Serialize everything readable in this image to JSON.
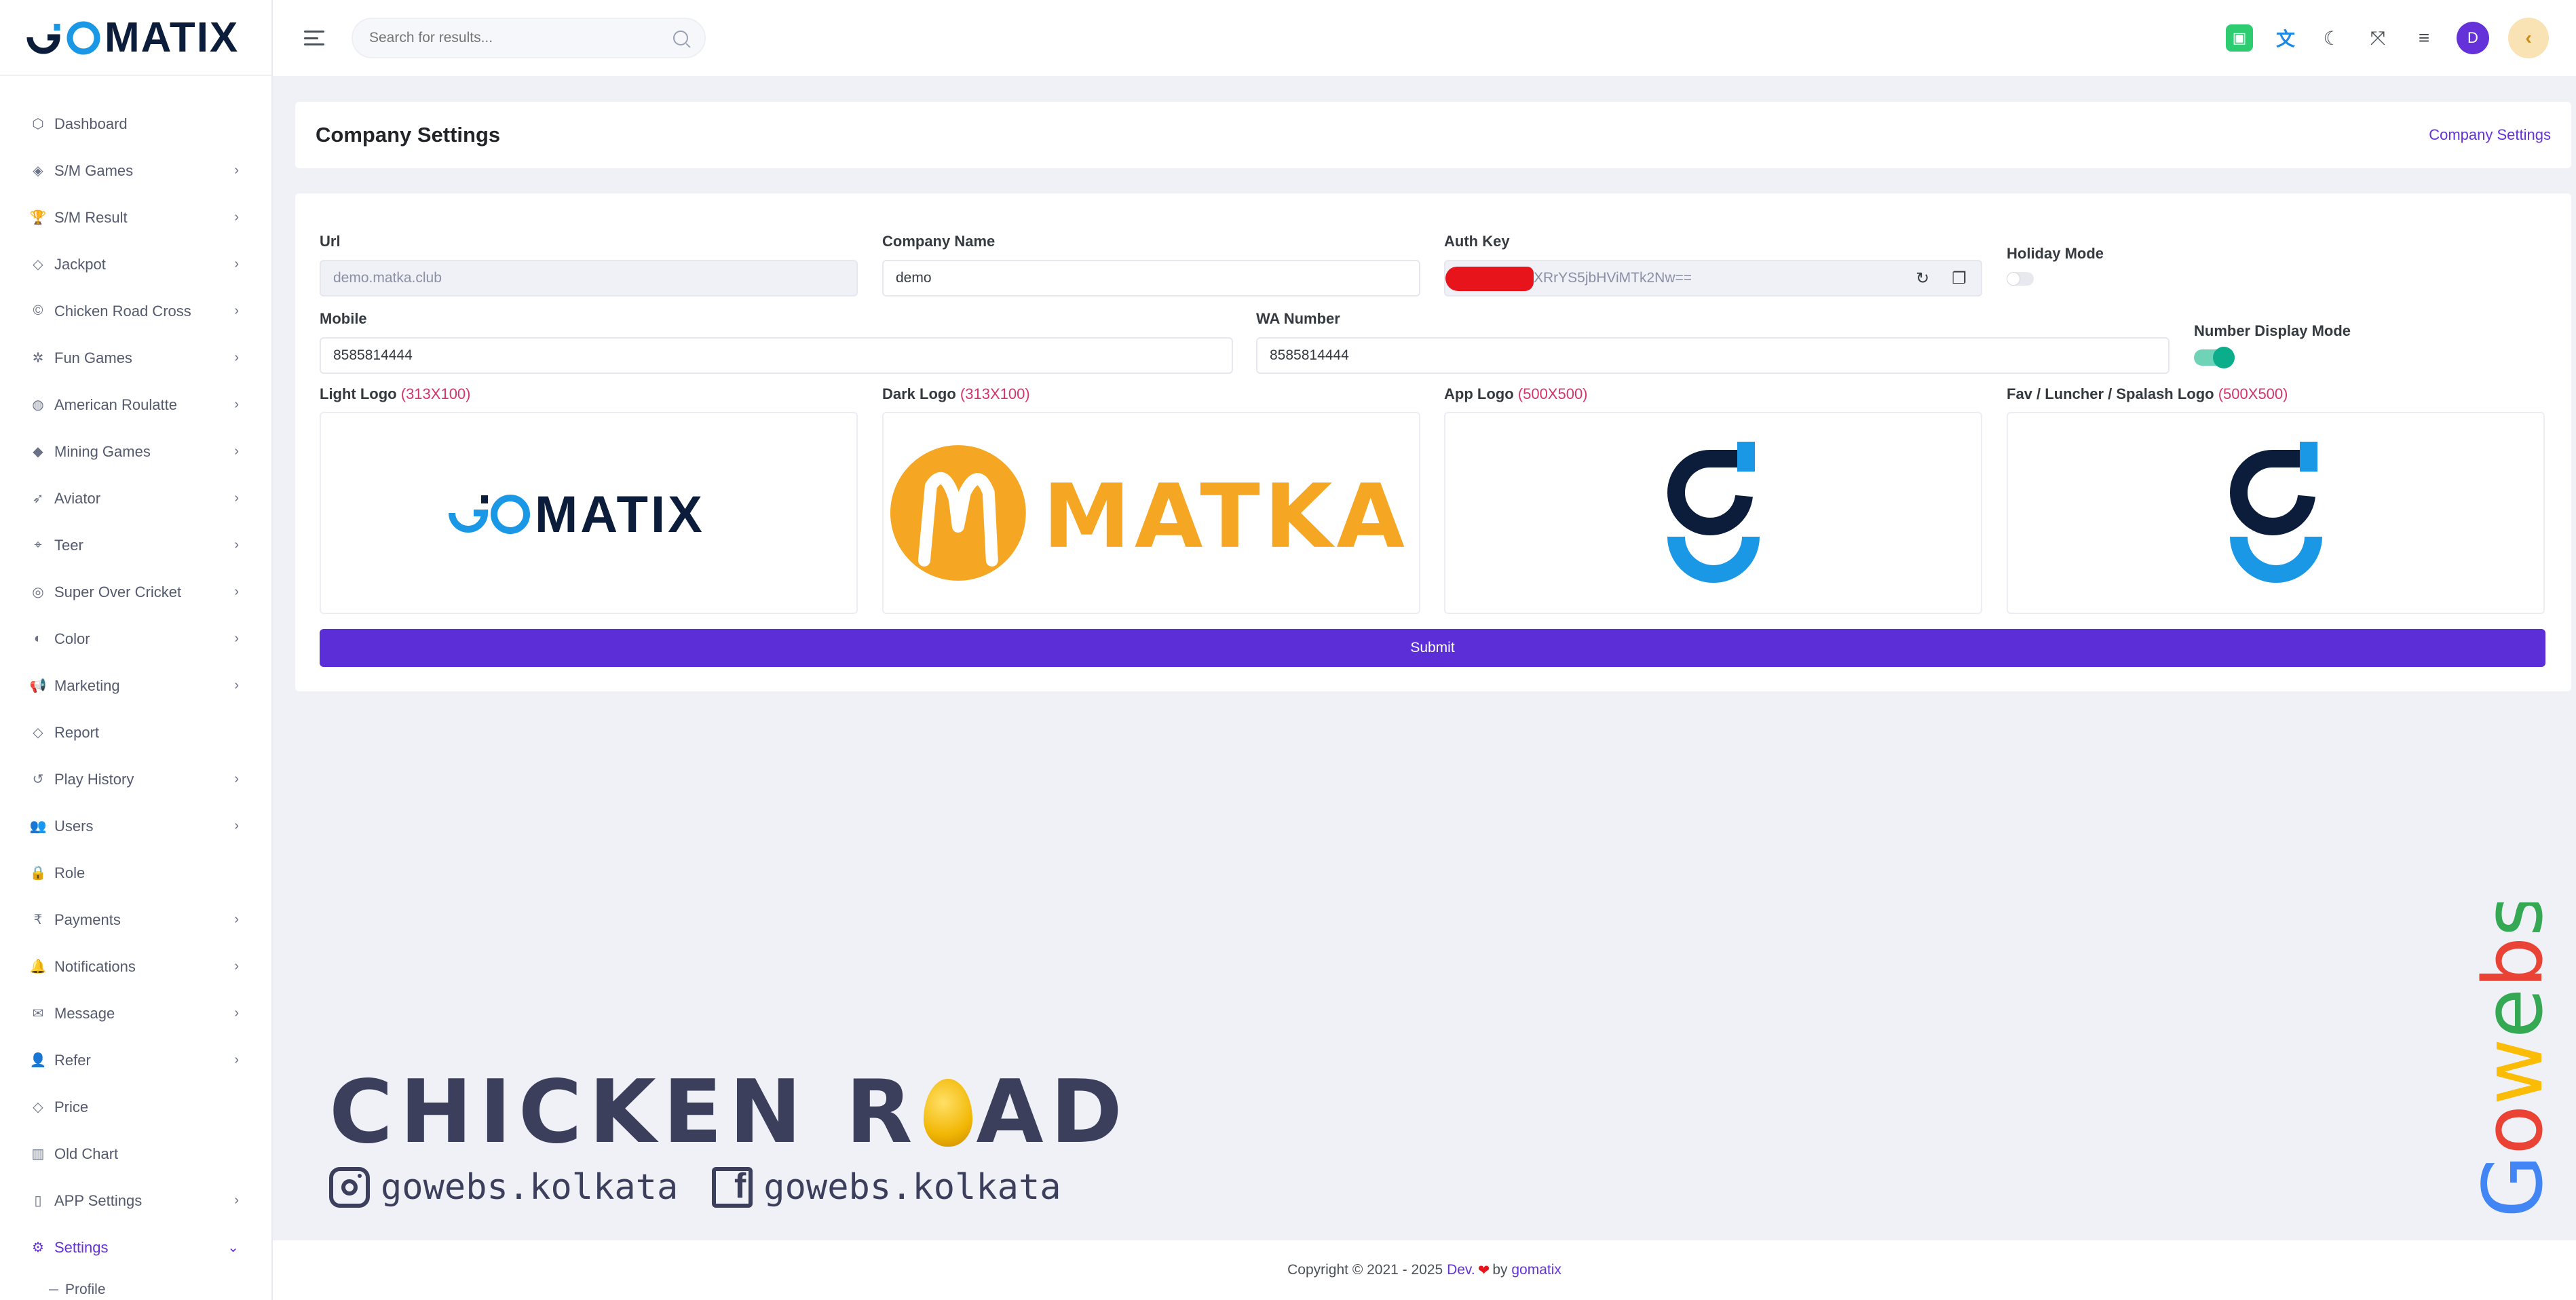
{
  "brand": {
    "name": "GOMATIX"
  },
  "sidebar": {
    "items": [
      {
        "label": "Dashboard",
        "icon": "cube-icon",
        "glyph": "⬡",
        "chevron": false
      },
      {
        "label": "S/M Games",
        "icon": "gamepad-icon",
        "glyph": "◈",
        "chevron": true
      },
      {
        "label": "S/M Result",
        "icon": "trophy-icon",
        "glyph": "🏆",
        "chevron": true
      },
      {
        "label": "Jackpot",
        "icon": "tag-icon",
        "glyph": "◇",
        "chevron": true
      },
      {
        "label": "Chicken Road Cross",
        "icon": "copyright-icon",
        "glyph": "©",
        "chevron": true
      },
      {
        "label": "Fun Games",
        "icon": "dharmachakra-icon",
        "glyph": "✲",
        "chevron": true
      },
      {
        "label": "American Roulatte",
        "icon": "globe-icon",
        "glyph": "◍",
        "chevron": true
      },
      {
        "label": "Mining Games",
        "icon": "gem-icon",
        "glyph": "◆",
        "chevron": true
      },
      {
        "label": "Aviator",
        "icon": "rocket-icon",
        "glyph": "➶",
        "chevron": true
      },
      {
        "label": "Teer",
        "icon": "crosshair-icon",
        "glyph": "⌖",
        "chevron": true
      },
      {
        "label": "Super Over Cricket",
        "icon": "baseball-icon",
        "glyph": "◎",
        "chevron": true
      },
      {
        "label": "Color",
        "icon": "half-circle-icon",
        "glyph": "◐",
        "chevron": true
      },
      {
        "label": "Marketing",
        "icon": "megaphone-icon",
        "glyph": "📢",
        "chevron": true
      },
      {
        "label": "Report",
        "icon": "tag-icon",
        "glyph": "◇",
        "chevron": false
      },
      {
        "label": "Play History",
        "icon": "history-icon",
        "glyph": "↺",
        "chevron": true
      },
      {
        "label": "Users",
        "icon": "users-icon",
        "glyph": "👥",
        "chevron": true
      },
      {
        "label": "Role",
        "icon": "lock-icon",
        "glyph": "🔒",
        "chevron": false
      },
      {
        "label": "Payments",
        "icon": "rupee-icon",
        "glyph": "₹",
        "chevron": true
      },
      {
        "label": "Notifications",
        "icon": "bell-icon",
        "glyph": "🔔",
        "chevron": true
      },
      {
        "label": "Message",
        "icon": "envelope-icon",
        "glyph": "✉",
        "chevron": true
      },
      {
        "label": "Refer",
        "icon": "user-plus-icon",
        "glyph": "👤",
        "chevron": true
      },
      {
        "label": "Price",
        "icon": "tag-icon",
        "glyph": "◇",
        "chevron": false
      },
      {
        "label": "Old Chart",
        "icon": "bar-chart-icon",
        "glyph": "▥",
        "chevron": false
      },
      {
        "label": "APP Settings",
        "icon": "mobile-icon",
        "glyph": "▯",
        "chevron": true
      },
      {
        "label": "Settings",
        "icon": "gear-icon",
        "glyph": "⚙",
        "chevron": true,
        "active": true
      }
    ],
    "submenu": [
      {
        "label": "Profile"
      }
    ]
  },
  "header": {
    "search_placeholder": "Search for results...",
    "avatar_initial": "D"
  },
  "page": {
    "title": "Company Settings",
    "breadcrumb": "Company Settings"
  },
  "form": {
    "url": {
      "label": "Url",
      "value": "demo.matka.club"
    },
    "company_name": {
      "label": "Company Name",
      "value": "demo"
    },
    "auth_key": {
      "label": "Auth Key",
      "value": "XRrYS5jbHViMTk2Nw=="
    },
    "holiday_mode": {
      "label": "Holiday Mode",
      "on": false
    },
    "mobile": {
      "label": "Mobile",
      "value": "8585814444"
    },
    "wa_number": {
      "label": "WA Number",
      "value": "8585814444"
    },
    "number_display_mode": {
      "label": "Number Display Mode",
      "on": true
    },
    "light_logo": {
      "label": "Light Logo",
      "size": "(313X100)"
    },
    "dark_logo": {
      "label": "Dark Logo",
      "size": "(313X100)",
      "text": "MATKA"
    },
    "app_logo": {
      "label": "App Logo",
      "size": "(500X500)"
    },
    "fav_logo": {
      "label": "Fav / Luncher / Spalash Logo",
      "size": "(500X500)"
    },
    "submit_label": "Submit"
  },
  "watermark": {
    "title_left": "CHICKEN R",
    "title_right": "AD",
    "instagram": "gowebs.kolkata",
    "facebook": "gowebs.kolkata",
    "side_brand": "Gowebs"
  },
  "footer": {
    "prefix": "Copyright © 2021 - 2025",
    "dev": "Dev.",
    "by": "by",
    "company": "gomatix"
  },
  "colors": {
    "accent": "#6532d9",
    "submit": "#5b2ed8",
    "toggle_on": "#0bae8a",
    "hint": "#d6336c",
    "logo_blue": "#1a98e6",
    "logo_dark": "#0b1d3a",
    "matka_orange": "#f5a623"
  }
}
